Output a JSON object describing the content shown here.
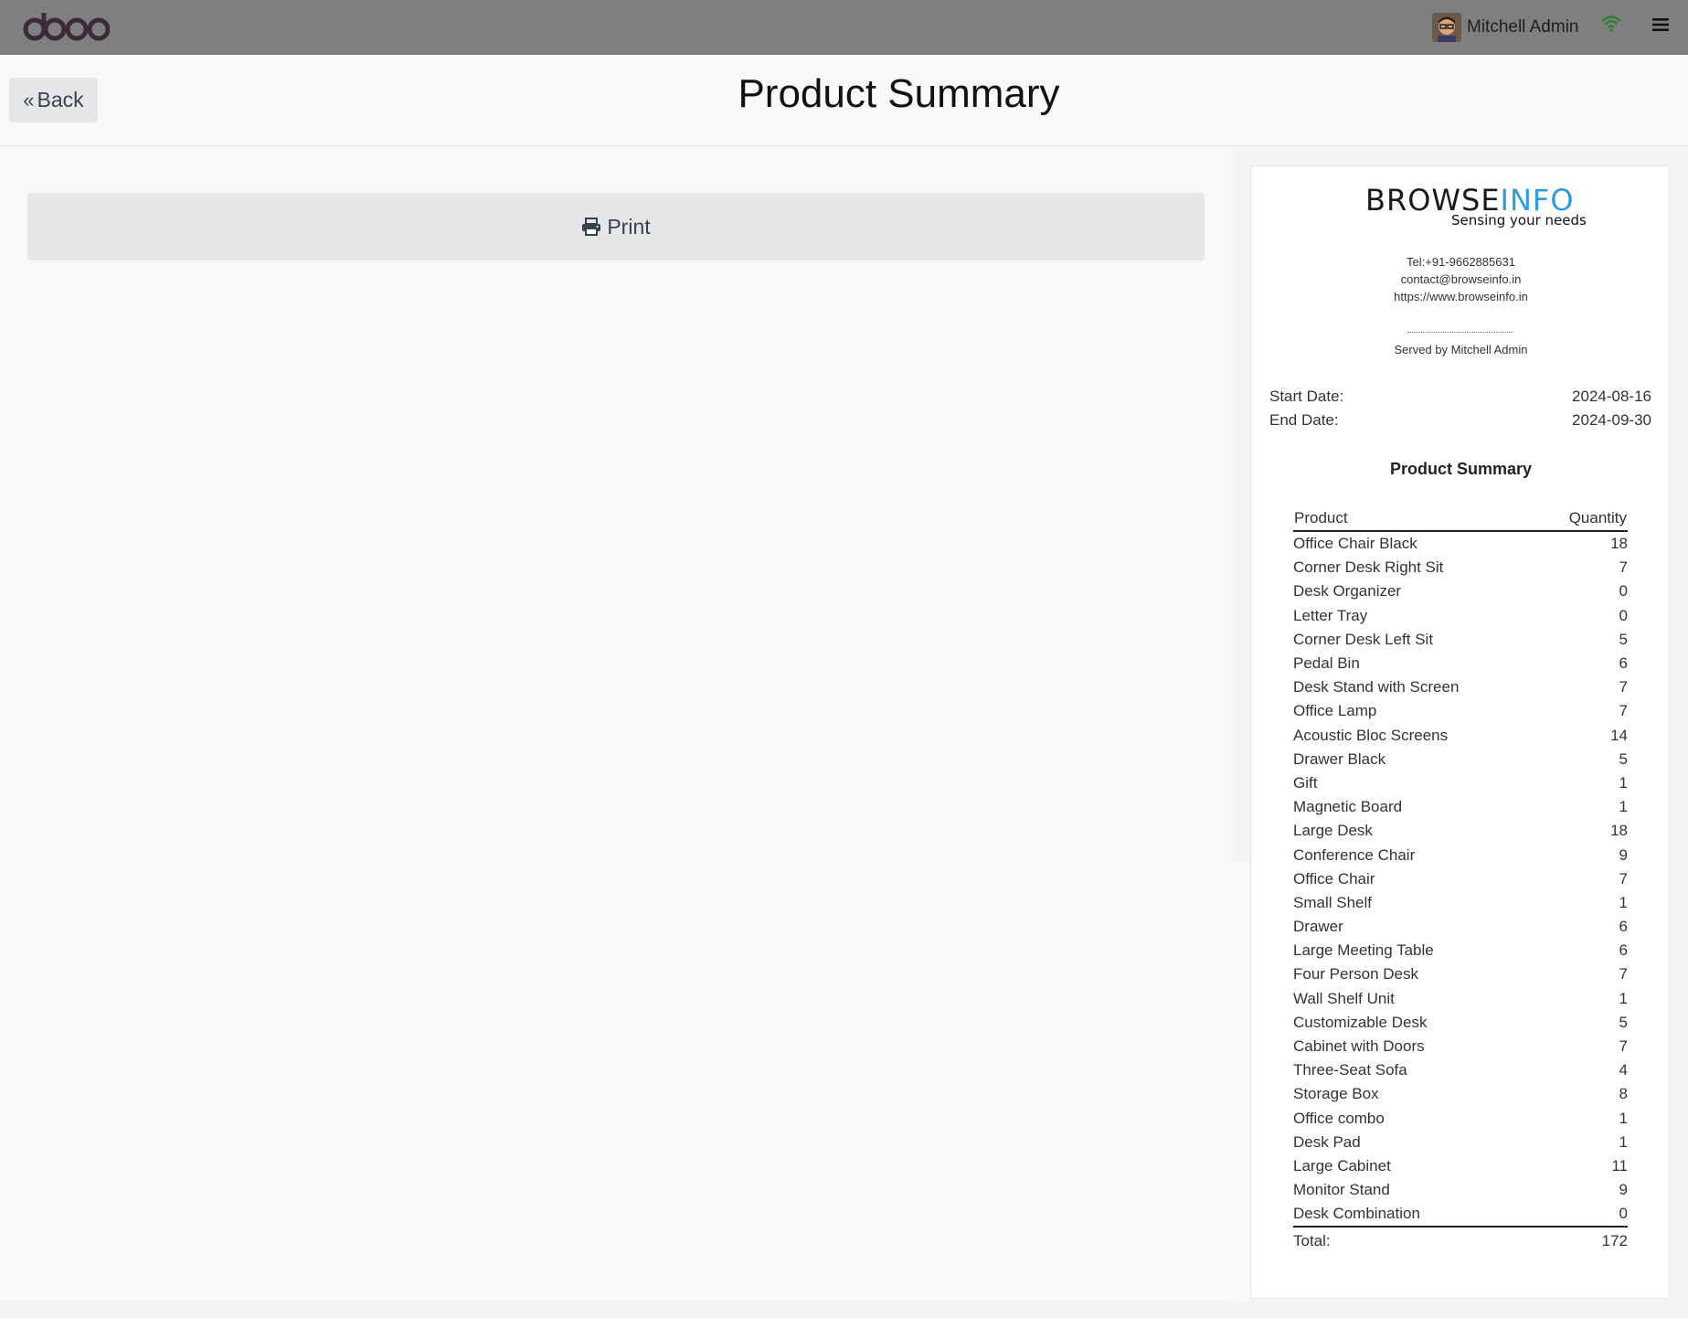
{
  "topbar": {
    "user_name": "Mitchell Admin"
  },
  "header": {
    "back_label": "Back",
    "title": "Product Summary"
  },
  "main": {
    "print_label": "Print"
  },
  "receipt": {
    "brand_part1": "BROWSE",
    "brand_part2": "INFO",
    "tagline": "Sensing your needs",
    "tel": "Tel:+91-9662885631",
    "email": "contact@browseinfo.in",
    "website": "https://www.browseinfo.in",
    "separator": "--------------------------------",
    "served_by": "Served by Mitchell Admin",
    "start_label": "Start Date:",
    "start_value": "2024-08-16",
    "end_label": "End Date:",
    "end_value": "2024-09-30",
    "title": "Product Summary",
    "col_product": "Product",
    "col_quantity": "Quantity",
    "items": [
      {
        "name": "Office Chair Black",
        "qty": "18"
      },
      {
        "name": "Corner Desk Right Sit",
        "qty": "7"
      },
      {
        "name": "Desk Organizer",
        "qty": "0"
      },
      {
        "name": "Letter Tray",
        "qty": "0"
      },
      {
        "name": "Corner Desk Left Sit",
        "qty": "5"
      },
      {
        "name": "Pedal Bin",
        "qty": "6"
      },
      {
        "name": "Desk Stand with Screen",
        "qty": "7"
      },
      {
        "name": "Office Lamp",
        "qty": "7"
      },
      {
        "name": "Acoustic Bloc Screens",
        "qty": "14"
      },
      {
        "name": "Drawer Black",
        "qty": "5"
      },
      {
        "name": "Gift",
        "qty": "1"
      },
      {
        "name": "Magnetic Board",
        "qty": "1"
      },
      {
        "name": "Large Desk",
        "qty": "18"
      },
      {
        "name": "Conference Chair",
        "qty": "9"
      },
      {
        "name": "Office Chair",
        "qty": "7"
      },
      {
        "name": "Small Shelf",
        "qty": "1"
      },
      {
        "name": "Drawer",
        "qty": "6"
      },
      {
        "name": "Large Meeting Table",
        "qty": "6"
      },
      {
        "name": "Four Person Desk",
        "qty": "7"
      },
      {
        "name": "Wall Shelf Unit",
        "qty": "1"
      },
      {
        "name": "Customizable Desk",
        "qty": "5"
      },
      {
        "name": "Cabinet with Doors",
        "qty": "7"
      },
      {
        "name": "Three-Seat Sofa",
        "qty": "4"
      },
      {
        "name": "Storage Box",
        "qty": "8"
      },
      {
        "name": "Office combo",
        "qty": "1"
      },
      {
        "name": "Desk Pad",
        "qty": "1"
      },
      {
        "name": "Large Cabinet",
        "qty": "11"
      },
      {
        "name": "Monitor Stand",
        "qty": "9"
      },
      {
        "name": "Desk Combination",
        "qty": "0"
      }
    ],
    "total_label": "Total:",
    "total_value": "172"
  },
  "colors": {
    "topbar": "#7f7f7f",
    "brand_accent": "#2d9cdb",
    "odoo_logo": "#3c2a3a",
    "wifi": "#2e7d32"
  },
  "icons": [
    "odoo-logo",
    "avatar",
    "wifi-icon",
    "hamburger-menu-icon",
    "double-chevron-left-icon",
    "printer-icon"
  ]
}
